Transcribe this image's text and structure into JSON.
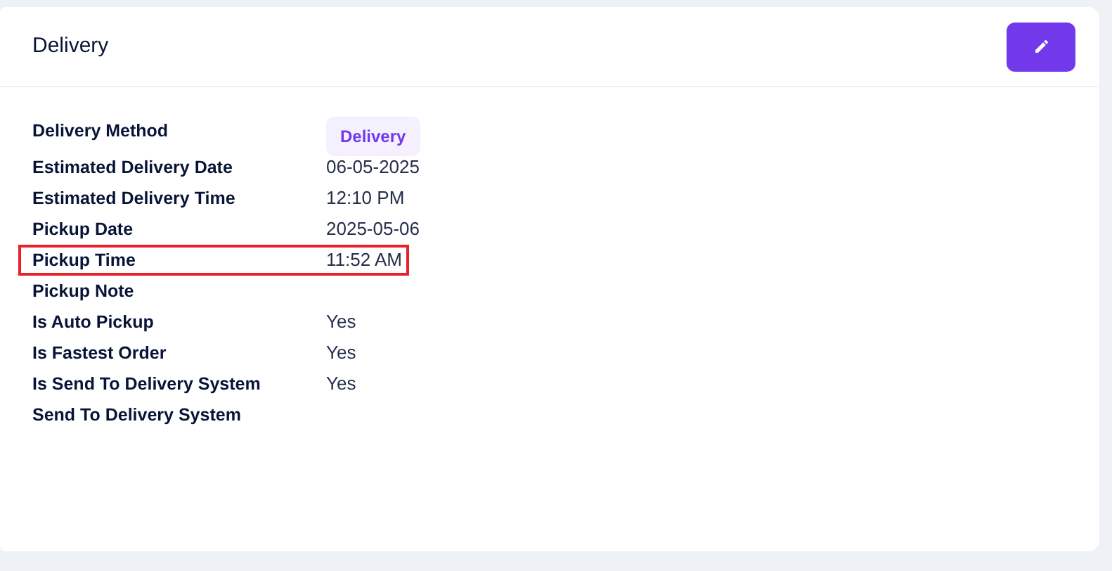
{
  "card": {
    "title": "Delivery"
  },
  "rows": [
    {
      "label": "Delivery Method",
      "value": "Delivery",
      "kind": "badge",
      "highlighted": false
    },
    {
      "label": "Estimated Delivery Date",
      "value": "06-05-2025",
      "kind": "text",
      "highlighted": false
    },
    {
      "label": "Estimated Delivery Time",
      "value": "12:10 PM",
      "kind": "text",
      "highlighted": false
    },
    {
      "label": "Pickup Date",
      "value": "2025-05-06",
      "kind": "text",
      "highlighted": false
    },
    {
      "label": "Pickup Time",
      "value": "11:52 AM",
      "kind": "text",
      "highlighted": true
    },
    {
      "label": "Pickup Note",
      "kind": "text",
      "highlighted": false
    },
    {
      "label": "Is Auto Pickup",
      "value": "Yes",
      "kind": "text",
      "highlighted": false
    },
    {
      "label": "Is Fastest Order",
      "value": "Yes",
      "kind": "text",
      "highlighted": false
    },
    {
      "label": "Is Send To Delivery System",
      "value": "Yes",
      "kind": "text",
      "highlighted": false
    },
    {
      "label": "Send To Delivery System",
      "kind": "text",
      "highlighted": false
    }
  ]
}
